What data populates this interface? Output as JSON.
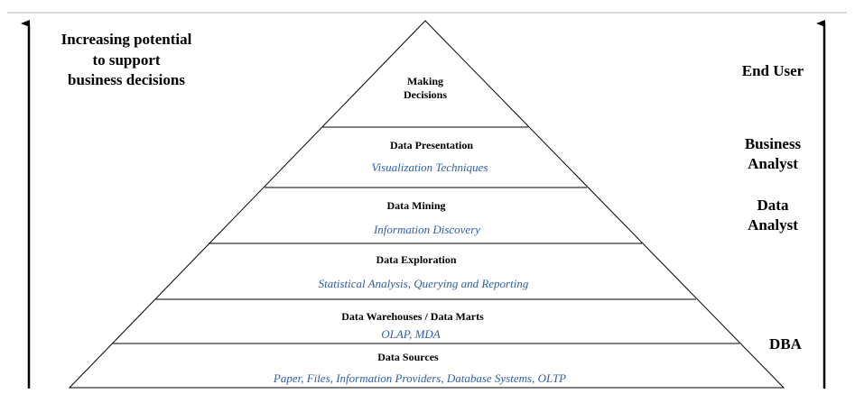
{
  "colors": {
    "line": "#000000",
    "top_rule": "#b0b0b0",
    "subtitle": "#2e5fa8"
  },
  "left_caption": {
    "line1": "Increasing potential",
    "line2": "to support",
    "line3": "business decisions"
  },
  "layers": [
    {
      "title_line1": "Making",
      "title_line2": "Decisions"
    },
    {
      "title": "Data Presentation",
      "subtitle": "Visualization Techniques"
    },
    {
      "title": "Data Mining",
      "subtitle": "Information Discovery"
    },
    {
      "title": "Data Exploration",
      "subtitle": "Statistical Analysis, Querying and Reporting"
    },
    {
      "title": "Data Warehouses / Data Marts",
      "subtitle": "OLAP, MDA"
    },
    {
      "title": "Data Sources",
      "subtitle": "Paper, Files, Information Providers, Database Systems, OLTP"
    }
  ],
  "roles": {
    "end_user": "End User",
    "business_analyst_line1": "Business",
    "business_analyst_line2": "Analyst",
    "data_analyst_line1": "Data",
    "data_analyst_line2": "Analyst",
    "dba": "DBA"
  }
}
